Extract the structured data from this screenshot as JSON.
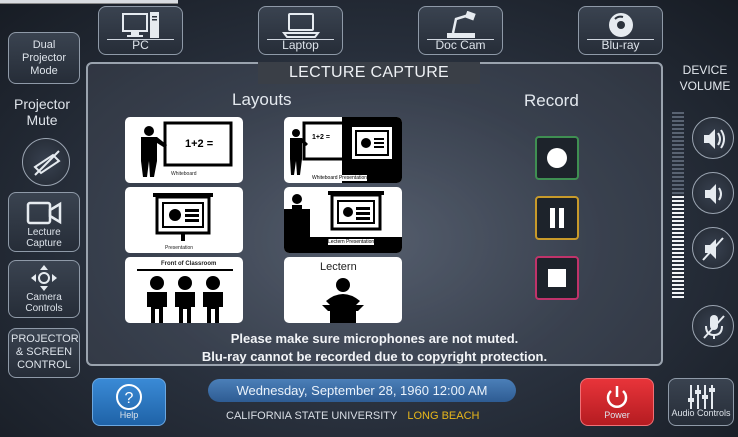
{
  "sources": [
    {
      "label": "PC",
      "icon": "desktop-pc-icon"
    },
    {
      "label": "Laptop",
      "icon": "laptop-icon"
    },
    {
      "label": "Doc Cam",
      "icon": "document-camera-icon"
    },
    {
      "label": "Blu-ray",
      "icon": "disc-icon"
    }
  ],
  "sidebar": {
    "dual_projector": "Dual Projector Mode",
    "projector_mute_label": "Projector Mute",
    "lecture_capture": "Lecture Capture",
    "camera_controls": "Camera Controls",
    "projector_screen": "PROJECTOR & SCREEN CONTROL"
  },
  "main": {
    "title": "LECTURE CAPTURE",
    "layouts_heading": "Layouts",
    "record_heading": "Record",
    "layouts": [
      {
        "caption": "Whiteboard",
        "eq": "1+2 ="
      },
      {
        "caption": "Whiteboard Presentation",
        "eq": "1+2 ="
      },
      {
        "caption": "Presentation"
      },
      {
        "caption": "Lectern Presentation"
      },
      {
        "caption": "Front of Classroom"
      },
      {
        "caption": "Lectern"
      }
    ],
    "notice_1": "Please make sure microphones are not muted.",
    "notice_2": "Blu-ray cannot be recorded due to copyright protection."
  },
  "volume": {
    "label": "DEVICE VOLUME",
    "level_fraction": 0.55
  },
  "footer": {
    "help_label": "Help",
    "datetime": "Wednesday, September 28, 1960 12:00 AM",
    "campus_name": "CALIFORNIA STATE UNIVERSITY",
    "campus_accent": "LONG BEACH",
    "power_label": "Power",
    "audio_label": "Audio Controls"
  },
  "colors": {
    "record": "#3f8f52",
    "pause": "#c89a2a",
    "stop": "#c0336a",
    "help": "#2a78c4",
    "power": "#d9262b",
    "accent": "#e8b71a"
  }
}
